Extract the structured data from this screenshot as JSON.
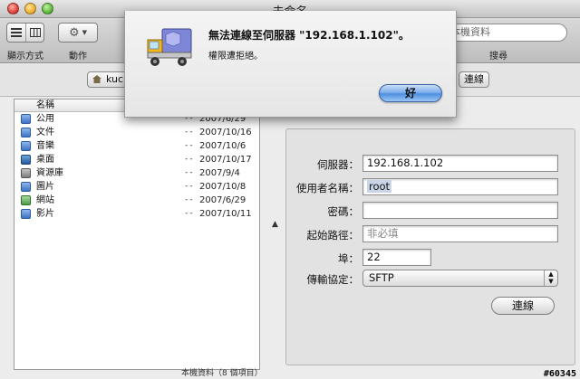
{
  "window": {
    "title": "未命名"
  },
  "toolbar": {
    "view_label": "顯示方式",
    "action_label": "動作",
    "search_placeholder": "本機資料",
    "search_label": "搜尋"
  },
  "location": {
    "popup_label": "kuc",
    "connect_label": "連線"
  },
  "file_list": {
    "header_name": "名稱",
    "rows": [
      {
        "name": "公用",
        "size": "--",
        "date": "2007/6/29",
        "icon": "public-folder-icon"
      },
      {
        "name": "文件",
        "size": "--",
        "date": "2007/10/16",
        "icon": "documents-folder-icon"
      },
      {
        "name": "音樂",
        "size": "--",
        "date": "2007/10/6",
        "icon": "music-folder-icon"
      },
      {
        "name": "桌面",
        "size": "--",
        "date": "2007/10/17",
        "icon": "desktop-folder-icon"
      },
      {
        "name": "資源庫",
        "size": "--",
        "date": "2007/9/4",
        "icon": "library-folder-icon"
      },
      {
        "name": "圖片",
        "size": "--",
        "date": "2007/10/8",
        "icon": "pictures-folder-icon"
      },
      {
        "name": "網站",
        "size": "--",
        "date": "2007/6/29",
        "icon": "sites-folder-icon"
      },
      {
        "name": "影片",
        "size": "--",
        "date": "2007/10/11",
        "icon": "movies-folder-icon"
      }
    ]
  },
  "form": {
    "server_label": "伺服器：",
    "server_value": "192.168.1.102",
    "user_label": "使用者名稱：",
    "user_value": "root",
    "password_label": "密碼：",
    "password_value": "",
    "path_label": "起始路徑：",
    "path_placeholder": "非必填",
    "port_label": "埠：",
    "port_value": "22",
    "protocol_label": "傳輸協定：",
    "protocol_value": "SFTP",
    "connect_label": "連線"
  },
  "status": {
    "text": "本機資料（8 個項目）"
  },
  "watermark": "#60345",
  "alert": {
    "message": "無法連線至伺服器 \"192.168.1.102\"。",
    "informative": "權限遭拒絕。",
    "ok_label": "好",
    "icon": "transmit-truck-icon"
  }
}
